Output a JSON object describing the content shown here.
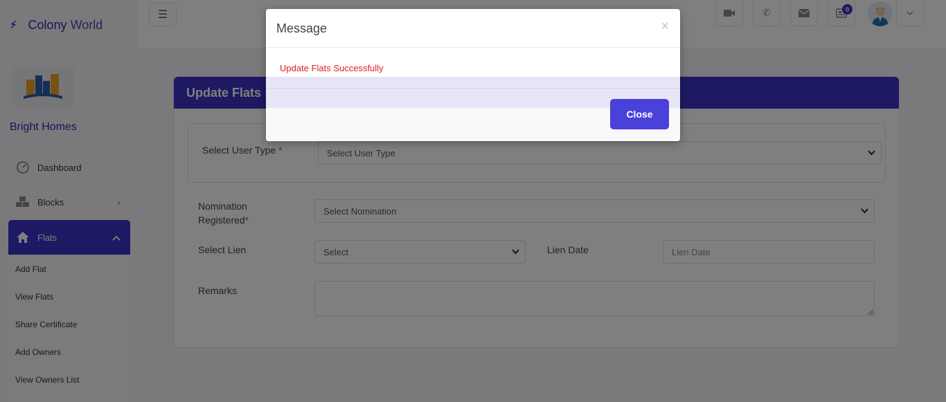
{
  "brand": {
    "word1": "Colony",
    "word2": "World"
  },
  "sidebar": {
    "org_name": "Bright Homes",
    "items": [
      {
        "label": "Dashboard",
        "icon": "dashboard-icon"
      },
      {
        "label": "Blocks",
        "icon": "cubes-icon"
      },
      {
        "label": "Flats",
        "icon": "home-icon"
      }
    ],
    "submenu": [
      "Add Flat",
      "View Flats",
      "Share Certificate",
      "Add Owners",
      "View Owners List"
    ]
  },
  "topbar": {
    "notification_count": "0"
  },
  "form": {
    "title": "Update Flats",
    "user_type_label": "Select User Type",
    "user_type_value": "Select User Type",
    "nomination_label_1": "Nomination",
    "nomination_label_2": "Registered",
    "nomination_value": "Select Nomination",
    "lien_label": "Select Lien",
    "lien_value": "Select",
    "lien_date_label": "Lien Date",
    "lien_date_placeholder": "Lien Date",
    "remarks_label": "Remarks",
    "required_mark": "*"
  },
  "modal": {
    "title": "Message",
    "close_x": "×",
    "message": "Update Flats Successfully",
    "close_label": "Close",
    "message_color": "#e01e1e",
    "accent": "#3a33c4"
  }
}
